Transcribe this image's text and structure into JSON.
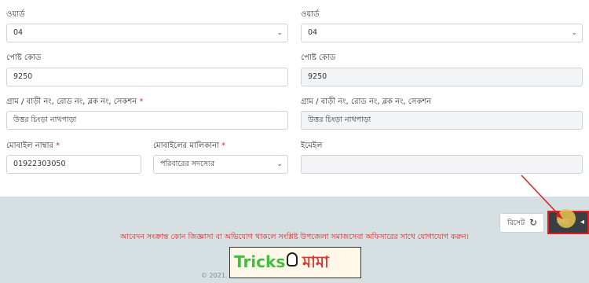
{
  "form": {
    "ward_left": {
      "label": "ওয়ার্ড",
      "value": "04"
    },
    "ward_right": {
      "label": "ওয়ার্ড",
      "value": "04"
    },
    "post_left": {
      "label": "পোষ্ট কোড",
      "value": "9250"
    },
    "post_right": {
      "label": "পোষ্ট কোড",
      "value": "9250"
    },
    "address_left": {
      "label": "গ্রাম / বাড়ী নং, রোড নং, ব্লক নং, সেকশন",
      "required": "*",
      "value": "উত্তর চিংড়া নাথপাড়া"
    },
    "address_right": {
      "label": "গ্রাম / বাড়ী নং, রোড নং, ব্লক নং, সেকশন",
      "value": "উত্তর চিংড়া নাথপাড়া"
    },
    "mobile": {
      "label": "মোবাইল নাম্বার",
      "required": "*",
      "value": "01922303050"
    },
    "ownership": {
      "label": "মোবাইলের মালিকানা",
      "required": "*",
      "value": "পরিবারের সদস্যের"
    },
    "email": {
      "label": "ইমেইল",
      "value": ""
    }
  },
  "actions": {
    "reset_label": "রিসেট",
    "reset_icon": "↻",
    "save_label": "সংর",
    "save_icon": "◂"
  },
  "notice": "আবেদন সংক্রান্ত কোন জিজ্ঞাসা বা অভিযোগ থাকলে সংশ্লিষ্ট উপজেলা সমাজসেবা অফিসারের সাথে যোগাযোগ করুন।",
  "copyright": "© 2021.",
  "watermark": {
    "part1": "Tricks",
    "part2": "মামা"
  },
  "colors": {
    "required": "#d32f2f",
    "notice": "#e01919",
    "footer_band": "#d6dfe1",
    "save_border": "#e11c1c"
  }
}
